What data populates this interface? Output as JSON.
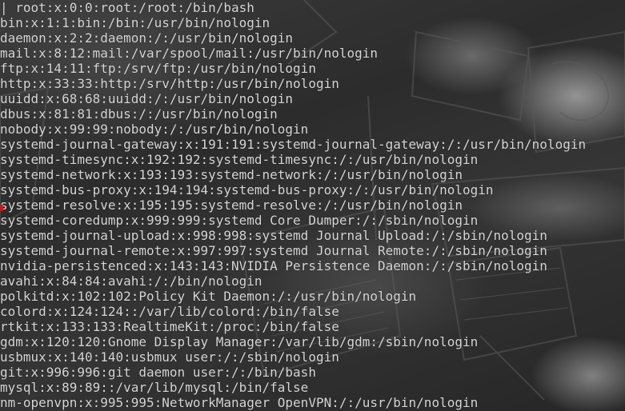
{
  "terminal": {
    "lines": [
      "| root:x:0:0:root:/root:/bin/bash",
      "bin:x:1:1:bin:/bin:/usr/bin/nologin",
      "daemon:x:2:2:daemon:/:/usr/bin/nologin",
      "mail:x:8:12:mail:/var/spool/mail:/usr/bin/nologin",
      "ftp:x:14:11:ftp:/srv/ftp:/usr/bin/nologin",
      "http:x:33:33:http:/srv/http:/usr/bin/nologin",
      "uuidd:x:68:68:uuidd:/:/usr/bin/nologin",
      "dbus:x:81:81:dbus:/:/usr/bin/nologin",
      "nobody:x:99:99:nobody:/:/usr/bin/nologin",
      "systemd-journal-gateway:x:191:191:systemd-journal-gateway:/:/usr/bin/nologin",
      "systemd-timesync:x:192:192:systemd-timesync:/:/usr/bin/nologin",
      "systemd-network:x:193:193:systemd-network:/:/usr/bin/nologin",
      "systemd-bus-proxy:x:194:194:systemd-bus-proxy:/:/usr/bin/nologin",
      "systemd-resolve:x:195:195:systemd-resolve:/:/usr/bin/nologin",
      "systemd-coredump:x:999:999:systemd Core Dumper:/:/sbin/nologin",
      "systemd-journal-upload:x:998:998:systemd Journal Upload:/:/sbin/nologin",
      "systemd-journal-remote:x:997:997:systemd Journal Remote:/:/sbin/nologin",
      "nvidia-persistenced:x:143:143:NVIDIA Persistence Daemon:/:/sbin/nologin",
      "avahi:x:84:84:avahi:/:/bin/nologin",
      "polkitd:x:102:102:Policy Kit Daemon:/:/usr/bin/nologin",
      "colord:x:124:124::/var/lib/colord:/bin/false",
      "rtkit:x:133:133:RealtimeKit:/proc:/bin/false",
      "gdm:x:120:120:Gnome Display Manager:/var/lib/gdm:/sbin/nologin",
      "usbmux:x:140:140:usbmux user:/:/sbin/nologin",
      "git:x:996:996:git daemon user:/:/bin/bash",
      "mysql:x:89:89::/var/lib/mysql:/bin/false",
      "nm-openvpn:x:995:995:NetworkManager OpenVPN:/:/usr/bin/nologin"
    ]
  }
}
